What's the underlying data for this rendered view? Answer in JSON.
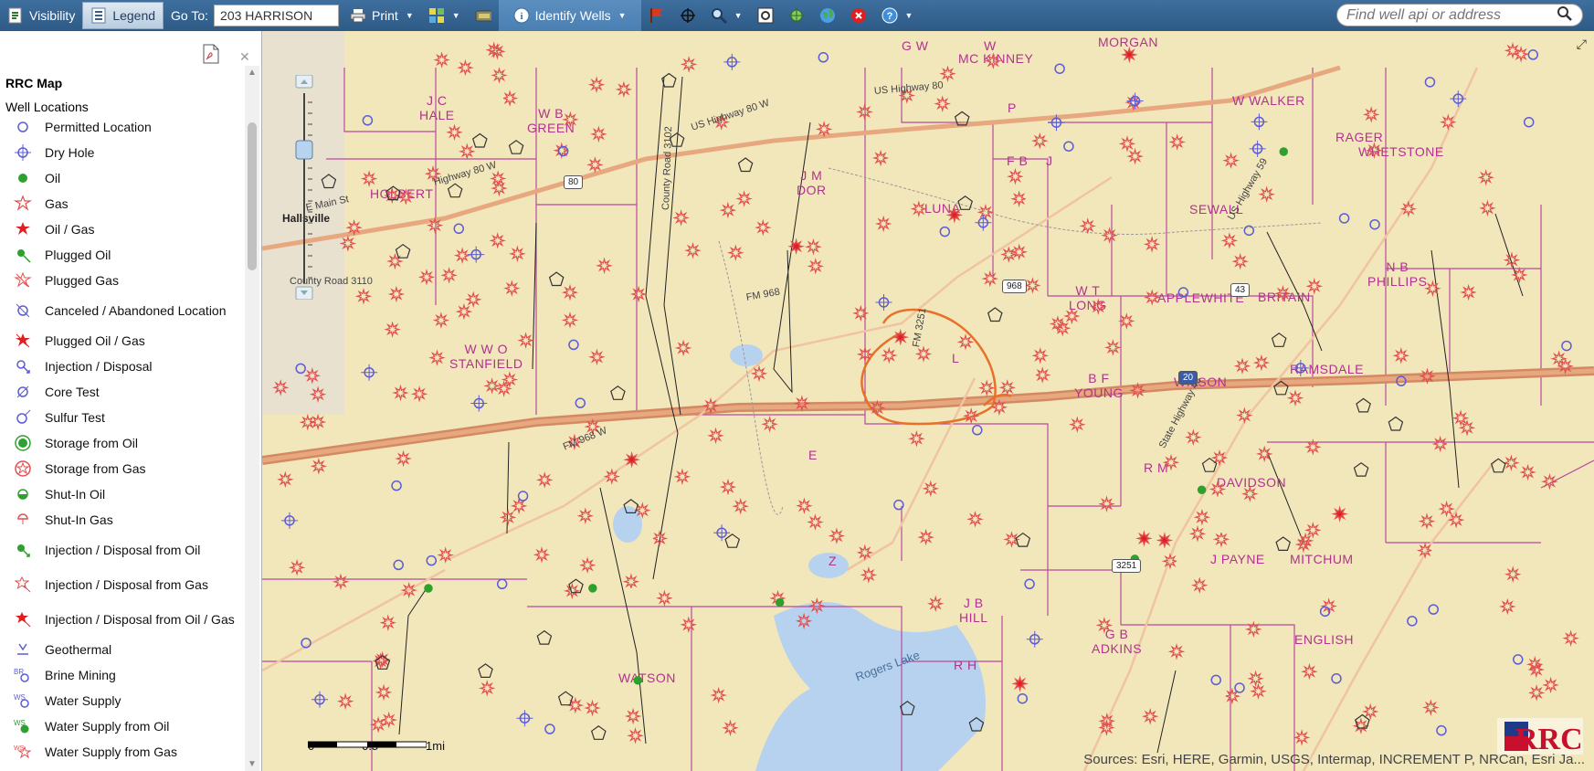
{
  "toolbar": {
    "visibility_label": "Visibility",
    "legend_label": "Legend",
    "goto_label": "Go To:",
    "goto_value": "203 HARRISON",
    "print_label": "Print",
    "identify_label": "Identify Wells",
    "search_placeholder": "Find well api or address"
  },
  "legend": {
    "title": "RRC Map",
    "subtitle": "Well Locations",
    "items": [
      {
        "label": "Permitted Location",
        "icon": "permitted-location-icon"
      },
      {
        "label": "Dry Hole",
        "icon": "dry-hole-icon"
      },
      {
        "label": "Oil",
        "icon": "oil-icon"
      },
      {
        "label": "Gas",
        "icon": "gas-icon"
      },
      {
        "label": "Oil / Gas",
        "icon": "oil-gas-icon"
      },
      {
        "label": "Plugged Oil",
        "icon": "plugged-oil-icon"
      },
      {
        "label": "Plugged Gas",
        "icon": "plugged-gas-icon"
      },
      {
        "label": "Canceled / Abandoned Location",
        "icon": "canceled-location-icon"
      },
      {
        "label": "Plugged Oil / Gas",
        "icon": "plugged-oil-gas-icon"
      },
      {
        "label": "Injection / Disposal",
        "icon": "injection-disposal-icon"
      },
      {
        "label": "Core Test",
        "icon": "core-test-icon"
      },
      {
        "label": "Sulfur Test",
        "icon": "sulfur-test-icon"
      },
      {
        "label": "Storage from Oil",
        "icon": "storage-oil-icon"
      },
      {
        "label": "Storage from Gas",
        "icon": "storage-gas-icon"
      },
      {
        "label": "Shut-In Oil",
        "icon": "shut-in-oil-icon"
      },
      {
        "label": "Shut-In Gas",
        "icon": "shut-in-gas-icon"
      },
      {
        "label": "Injection / Disposal from Oil",
        "icon": "injection-oil-icon"
      },
      {
        "label": "Injection / Disposal from Gas",
        "icon": "injection-gas-icon"
      },
      {
        "label": "Injection / Disposal from Oil / Gas",
        "icon": "injection-oil-gas-icon"
      },
      {
        "label": "Geothermal",
        "icon": "geothermal-icon"
      },
      {
        "label": "Brine Mining",
        "icon": "brine-mining-icon"
      },
      {
        "label": "Water Supply",
        "icon": "water-supply-icon"
      },
      {
        "label": "Water Supply from Oil",
        "icon": "water-supply-oil-icon"
      },
      {
        "label": "Water Supply from Gas",
        "icon": "water-supply-gas-icon"
      }
    ]
  },
  "map": {
    "labels": [
      "G W",
      "W",
      "MC KINNEY",
      "MORGAN",
      "J C HALE",
      "W B GREEN",
      "HOLBERT",
      "J M DOR",
      "LUNA",
      "W WALKER",
      "RAGER",
      "WHETSTONE",
      "SEWALL",
      "W T LONG",
      "APPLEWHITE",
      "BRITAIN",
      "N B PHILLIPS",
      "W W O STANFIELD",
      "B F YOUNG",
      "WILSON",
      "RAMSDALE",
      "DAVIDSON",
      "R M",
      "MITCHUM",
      "J PAYNE",
      "J B HILL",
      "G B ADKINS",
      "ENGLISH",
      "R H",
      "WATSON",
      "F B",
      "J",
      "L",
      "P",
      "Z",
      "E"
    ],
    "roads": [
      "US Highway 80",
      "US Highway 80 W",
      "E Main St",
      "Highway 80 W",
      "FM 968",
      "FM 968 W",
      "County Road 3102",
      "County Road 3110",
      "FM 3251",
      "US Highway 59",
      "State Highway 43",
      "Rogers Lake"
    ],
    "road_shields": [
      "80",
      "968",
      "20",
      "43",
      "3251"
    ],
    "town": "Hallsville",
    "scale_labels": [
      "0",
      "0.5",
      "1mi"
    ],
    "attribution": "Sources: Esri, HERE, Garmin, USGS, Intermap, INCREMENT P, NRCan, Esri Ja...",
    "logo_text": "RRC",
    "accent_color": "#e8712a"
  }
}
